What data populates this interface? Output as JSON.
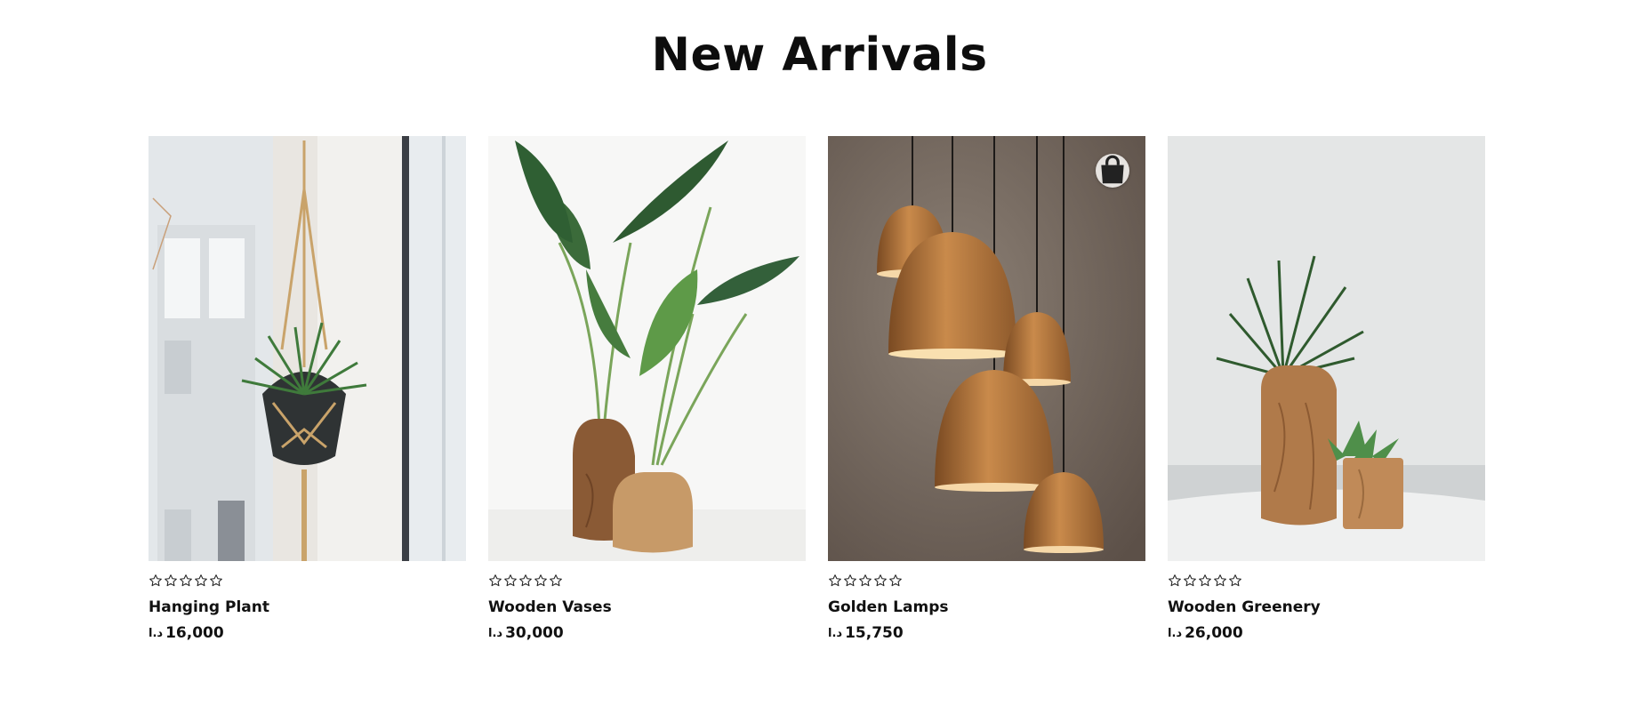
{
  "section": {
    "title": "New Arrivals"
  },
  "products": [
    {
      "name": "Hanging Plant",
      "currency": "د.ا",
      "price": "16,000",
      "rating": 0,
      "image": "hanging-plant-photo"
    },
    {
      "name": "Wooden Vases",
      "currency": "د.ا",
      "price": "30,000",
      "rating": 0,
      "image": "wooden-vases-photo"
    },
    {
      "name": "Golden Lamps",
      "currency": "د.ا",
      "price": "15,750",
      "rating": 0,
      "image": "golden-lamps-photo",
      "icon": "shopping-bag-icon"
    },
    {
      "name": "Wooden Greenery",
      "currency": "د.ا",
      "price": "26,000",
      "rating": 0,
      "image": "wooden-greenery-photo"
    }
  ],
  "colors": {
    "text": "#111111",
    "accent_copper": "#b87333",
    "bag_button": "#e6e3e0"
  }
}
